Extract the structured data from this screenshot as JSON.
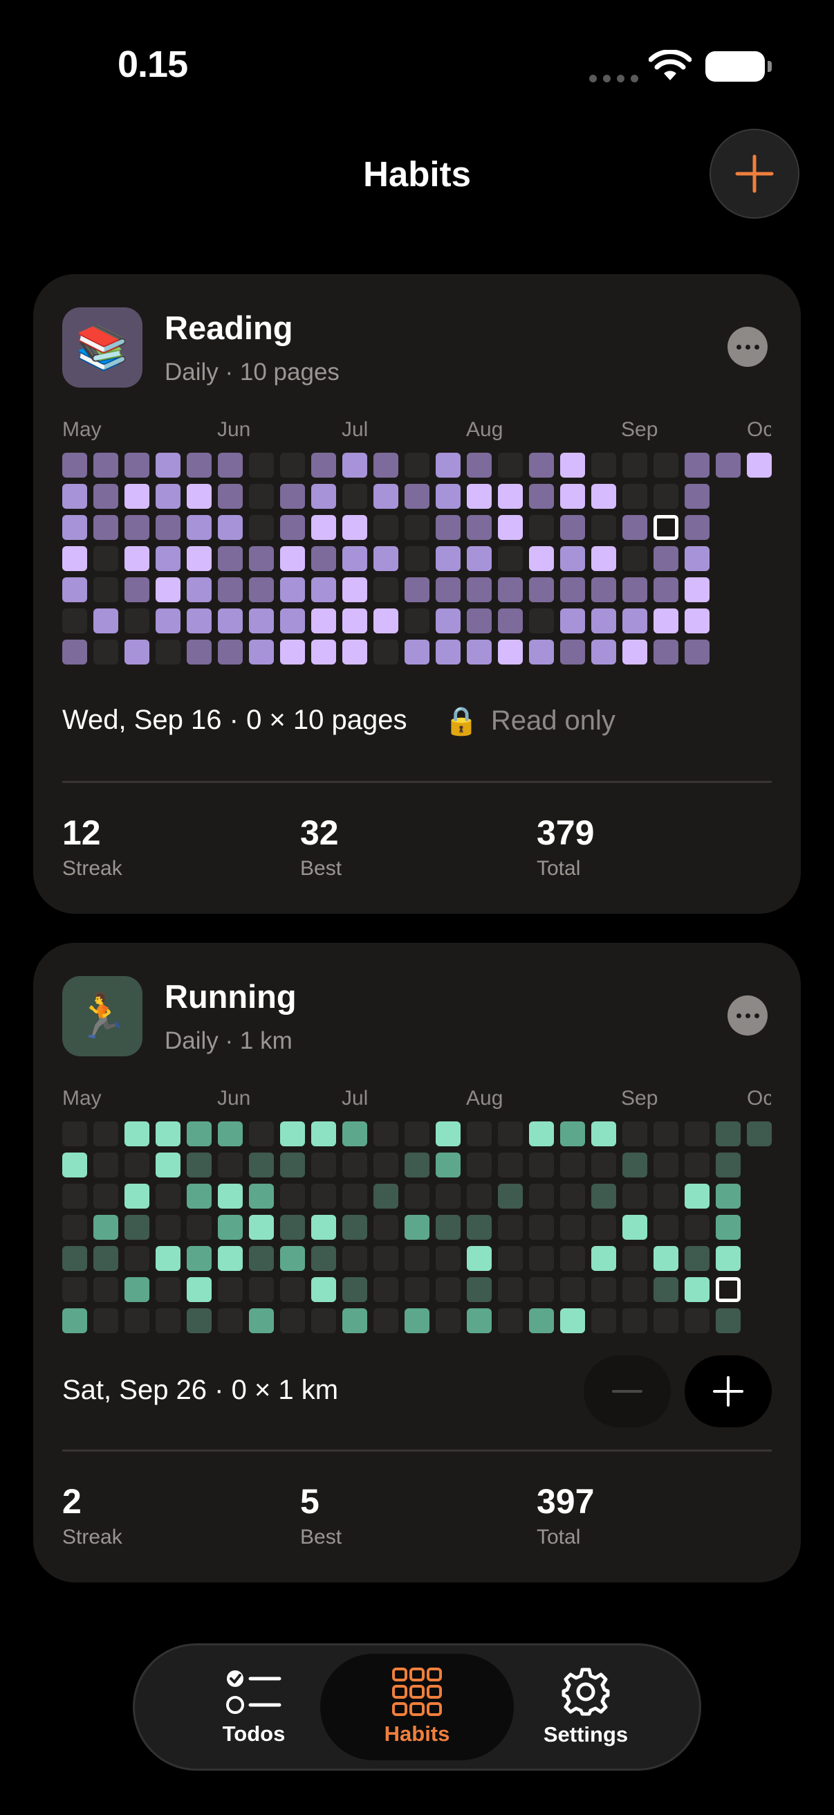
{
  "status": {
    "time": "0.15"
  },
  "header": {
    "title": "Habits"
  },
  "habits": [
    {
      "name": "Reading",
      "icon": "books-icon",
      "icon_emoji": "📚",
      "subtitle": "Daily · 10 pages",
      "months": [
        "May",
        "Jun",
        "Jul",
        "Aug",
        "Sep",
        "Oc"
      ],
      "day_text": "Wed, Sep 16 · 0 × 10 pages",
      "read_only_label": "Read only",
      "stats": [
        {
          "value": "12",
          "label": "Streak"
        },
        {
          "value": "32",
          "label": "Best"
        },
        {
          "value": "379",
          "label": "Total"
        }
      ],
      "colors": {
        "none": "#2a2827",
        "low": "#7d6b9b",
        "mid": "#a793d8",
        "high": "#d6bcff",
        "tile": "#5b506a"
      },
      "levels": [
        [
          1,
          1,
          1,
          2,
          1,
          1,
          0,
          0,
          1,
          2,
          1,
          0,
          2,
          1,
          0,
          1,
          3,
          0,
          0,
          0,
          1,
          1,
          3
        ],
        [
          2,
          1,
          3,
          2,
          3,
          1,
          0,
          1,
          2,
          0,
          2,
          1,
          2,
          3,
          3,
          1,
          3,
          3,
          0,
          0,
          1,
          -1,
          -1
        ],
        [
          2,
          1,
          1,
          1,
          2,
          2,
          0,
          1,
          3,
          3,
          0,
          0,
          1,
          1,
          3,
          0,
          1,
          0,
          1,
          -2,
          1,
          -1,
          -1
        ],
        [
          3,
          0,
          3,
          2,
          3,
          1,
          1,
          3,
          1,
          2,
          2,
          0,
          2,
          2,
          0,
          3,
          2,
          3,
          0,
          1,
          2,
          -1,
          -1
        ],
        [
          2,
          0,
          1,
          3,
          2,
          1,
          1,
          2,
          2,
          3,
          0,
          1,
          1,
          1,
          1,
          1,
          1,
          1,
          1,
          1,
          3,
          -1,
          -1
        ],
        [
          0,
          2,
          0,
          2,
          2,
          2,
          2,
          2,
          3,
          3,
          3,
          0,
          2,
          1,
          1,
          0,
          2,
          2,
          2,
          3,
          3,
          -1,
          -1
        ],
        [
          1,
          0,
          2,
          0,
          1,
          1,
          2,
          3,
          3,
          3,
          0,
          2,
          2,
          2,
          3,
          2,
          1,
          2,
          3,
          1,
          1,
          -1,
          -1
        ]
      ]
    },
    {
      "name": "Running",
      "icon": "runner-icon",
      "icon_emoji": "🏃",
      "subtitle": "Daily · 1 km",
      "months": [
        "May",
        "Jun",
        "Jul",
        "Aug",
        "Sep",
        "Oc"
      ],
      "day_text": "Sat, Sep 26 · 0 × 1 km",
      "stats": [
        {
          "value": "2",
          "label": "Streak"
        },
        {
          "value": "5",
          "label": "Best"
        },
        {
          "value": "397",
          "label": "Total"
        }
      ],
      "colors": {
        "none": "#2a2827",
        "low": "#3f5a4f",
        "mid": "#5da88c",
        "high": "#8de2c3",
        "tile": "#3d5448"
      },
      "levels": [
        [
          0,
          0,
          3,
          3,
          2,
          2,
          0,
          3,
          3,
          2,
          0,
          0,
          3,
          0,
          0,
          3,
          2,
          3,
          0,
          0,
          0,
          1,
          1
        ],
        [
          3,
          0,
          0,
          3,
          1,
          0,
          1,
          1,
          0,
          0,
          0,
          1,
          2,
          0,
          0,
          0,
          0,
          0,
          1,
          0,
          0,
          1,
          -1
        ],
        [
          0,
          0,
          3,
          0,
          2,
          3,
          2,
          0,
          0,
          0,
          1,
          0,
          0,
          0,
          1,
          0,
          0,
          1,
          0,
          0,
          3,
          2,
          -1
        ],
        [
          0,
          2,
          1,
          0,
          0,
          2,
          3,
          1,
          3,
          1,
          0,
          2,
          1,
          1,
          0,
          0,
          0,
          0,
          3,
          0,
          0,
          2,
          -1
        ],
        [
          1,
          1,
          0,
          3,
          2,
          3,
          1,
          2,
          1,
          0,
          0,
          0,
          0,
          3,
          0,
          0,
          0,
          3,
          0,
          3,
          1,
          3,
          -1
        ],
        [
          0,
          0,
          2,
          0,
          3,
          0,
          0,
          0,
          3,
          1,
          0,
          0,
          0,
          1,
          0,
          0,
          0,
          0,
          0,
          1,
          3,
          -2,
          -1
        ],
        [
          2,
          0,
          0,
          0,
          1,
          0,
          2,
          0,
          0,
          2,
          0,
          2,
          0,
          2,
          0,
          2,
          3,
          0,
          0,
          0,
          0,
          1,
          -1
        ]
      ]
    }
  ],
  "tabs": [
    {
      "label": "Todos",
      "icon": "todos-icon"
    },
    {
      "label": "Habits",
      "icon": "grid-icon",
      "active": true
    },
    {
      "label": "Settings",
      "icon": "gear-icon"
    }
  ],
  "colors": {
    "accent": "#f07f3c",
    "background": "#000000",
    "card": "#1c1a19"
  }
}
